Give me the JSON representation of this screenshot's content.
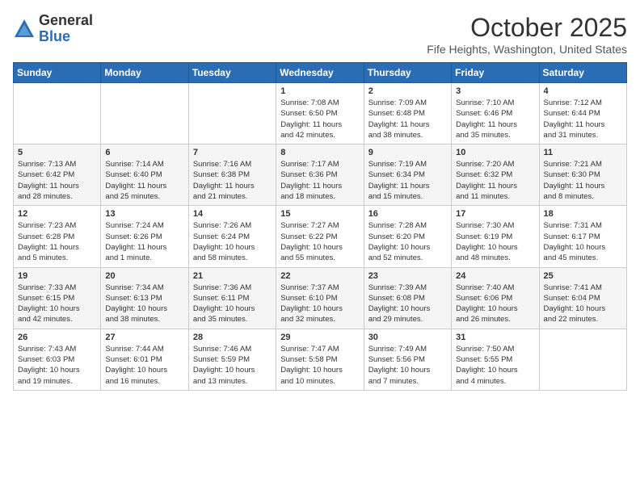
{
  "logo": {
    "general": "General",
    "blue": "Blue"
  },
  "header": {
    "title": "October 2025",
    "location": "Fife Heights, Washington, United States"
  },
  "weekdays": [
    "Sunday",
    "Monday",
    "Tuesday",
    "Wednesday",
    "Thursday",
    "Friday",
    "Saturday"
  ],
  "weeks": [
    [
      {
        "day": "",
        "detail": ""
      },
      {
        "day": "",
        "detail": ""
      },
      {
        "day": "",
        "detail": ""
      },
      {
        "day": "1",
        "detail": "Sunrise: 7:08 AM\nSunset: 6:50 PM\nDaylight: 11 hours\nand 42 minutes."
      },
      {
        "day": "2",
        "detail": "Sunrise: 7:09 AM\nSunset: 6:48 PM\nDaylight: 11 hours\nand 38 minutes."
      },
      {
        "day": "3",
        "detail": "Sunrise: 7:10 AM\nSunset: 6:46 PM\nDaylight: 11 hours\nand 35 minutes."
      },
      {
        "day": "4",
        "detail": "Sunrise: 7:12 AM\nSunset: 6:44 PM\nDaylight: 11 hours\nand 31 minutes."
      }
    ],
    [
      {
        "day": "5",
        "detail": "Sunrise: 7:13 AM\nSunset: 6:42 PM\nDaylight: 11 hours\nand 28 minutes."
      },
      {
        "day": "6",
        "detail": "Sunrise: 7:14 AM\nSunset: 6:40 PM\nDaylight: 11 hours\nand 25 minutes."
      },
      {
        "day": "7",
        "detail": "Sunrise: 7:16 AM\nSunset: 6:38 PM\nDaylight: 11 hours\nand 21 minutes."
      },
      {
        "day": "8",
        "detail": "Sunrise: 7:17 AM\nSunset: 6:36 PM\nDaylight: 11 hours\nand 18 minutes."
      },
      {
        "day": "9",
        "detail": "Sunrise: 7:19 AM\nSunset: 6:34 PM\nDaylight: 11 hours\nand 15 minutes."
      },
      {
        "day": "10",
        "detail": "Sunrise: 7:20 AM\nSunset: 6:32 PM\nDaylight: 11 hours\nand 11 minutes."
      },
      {
        "day": "11",
        "detail": "Sunrise: 7:21 AM\nSunset: 6:30 PM\nDaylight: 11 hours\nand 8 minutes."
      }
    ],
    [
      {
        "day": "12",
        "detail": "Sunrise: 7:23 AM\nSunset: 6:28 PM\nDaylight: 11 hours\nand 5 minutes."
      },
      {
        "day": "13",
        "detail": "Sunrise: 7:24 AM\nSunset: 6:26 PM\nDaylight: 11 hours\nand 1 minute."
      },
      {
        "day": "14",
        "detail": "Sunrise: 7:26 AM\nSunset: 6:24 PM\nDaylight: 10 hours\nand 58 minutes."
      },
      {
        "day": "15",
        "detail": "Sunrise: 7:27 AM\nSunset: 6:22 PM\nDaylight: 10 hours\nand 55 minutes."
      },
      {
        "day": "16",
        "detail": "Sunrise: 7:28 AM\nSunset: 6:20 PM\nDaylight: 10 hours\nand 52 minutes."
      },
      {
        "day": "17",
        "detail": "Sunrise: 7:30 AM\nSunset: 6:19 PM\nDaylight: 10 hours\nand 48 minutes."
      },
      {
        "day": "18",
        "detail": "Sunrise: 7:31 AM\nSunset: 6:17 PM\nDaylight: 10 hours\nand 45 minutes."
      }
    ],
    [
      {
        "day": "19",
        "detail": "Sunrise: 7:33 AM\nSunset: 6:15 PM\nDaylight: 10 hours\nand 42 minutes."
      },
      {
        "day": "20",
        "detail": "Sunrise: 7:34 AM\nSunset: 6:13 PM\nDaylight: 10 hours\nand 38 minutes."
      },
      {
        "day": "21",
        "detail": "Sunrise: 7:36 AM\nSunset: 6:11 PM\nDaylight: 10 hours\nand 35 minutes."
      },
      {
        "day": "22",
        "detail": "Sunrise: 7:37 AM\nSunset: 6:10 PM\nDaylight: 10 hours\nand 32 minutes."
      },
      {
        "day": "23",
        "detail": "Sunrise: 7:39 AM\nSunset: 6:08 PM\nDaylight: 10 hours\nand 29 minutes."
      },
      {
        "day": "24",
        "detail": "Sunrise: 7:40 AM\nSunset: 6:06 PM\nDaylight: 10 hours\nand 26 minutes."
      },
      {
        "day": "25",
        "detail": "Sunrise: 7:41 AM\nSunset: 6:04 PM\nDaylight: 10 hours\nand 22 minutes."
      }
    ],
    [
      {
        "day": "26",
        "detail": "Sunrise: 7:43 AM\nSunset: 6:03 PM\nDaylight: 10 hours\nand 19 minutes."
      },
      {
        "day": "27",
        "detail": "Sunrise: 7:44 AM\nSunset: 6:01 PM\nDaylight: 10 hours\nand 16 minutes."
      },
      {
        "day": "28",
        "detail": "Sunrise: 7:46 AM\nSunset: 5:59 PM\nDaylight: 10 hours\nand 13 minutes."
      },
      {
        "day": "29",
        "detail": "Sunrise: 7:47 AM\nSunset: 5:58 PM\nDaylight: 10 hours\nand 10 minutes."
      },
      {
        "day": "30",
        "detail": "Sunrise: 7:49 AM\nSunset: 5:56 PM\nDaylight: 10 hours\nand 7 minutes."
      },
      {
        "day": "31",
        "detail": "Sunrise: 7:50 AM\nSunset: 5:55 PM\nDaylight: 10 hours\nand 4 minutes."
      },
      {
        "day": "",
        "detail": ""
      }
    ]
  ]
}
